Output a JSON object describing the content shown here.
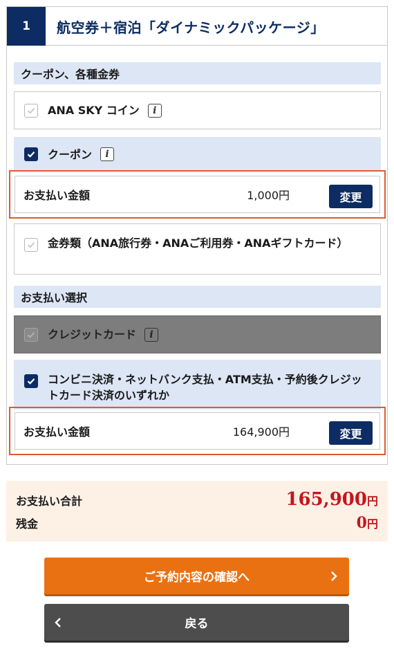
{
  "step": {
    "number": "1",
    "title": "航空券＋宿泊「ダイナミックパッケージ」"
  },
  "coupons": {
    "section_label": "クーポン、各種金券",
    "sky_coin": {
      "label": "ANA SKY コイン",
      "checked": false
    },
    "coupon": {
      "label": "クーポン",
      "checked": true,
      "payment_label": "お支払い金額",
      "payment_amount": "1,000円",
      "change_label": "変更"
    },
    "vouchers": {
      "label": "金券類（ANA旅行券・ANAご利用券・ANAギフトカード）",
      "checked": false
    }
  },
  "payment": {
    "section_label": "お支払い選択",
    "credit": {
      "label": "クレジットカード",
      "checked": false,
      "disabled": true
    },
    "convenience": {
      "label": "コンビニ決済・ネットバンク支払・ATM支払・予約後クレジットカード決済のいずれか",
      "checked": true,
      "payment_label": "お支払い金額",
      "payment_amount": "164,900円",
      "change_label": "変更"
    }
  },
  "summary": {
    "total_label": "お支払い合計",
    "total_value": "165,900",
    "total_unit": "円",
    "balance_label": "残金",
    "balance_value": "0",
    "balance_unit": "円"
  },
  "buttons": {
    "confirm_label": "ご予約内容の確認へ",
    "back_label": "戻る"
  },
  "colors": {
    "navy": "#0c2c63",
    "highlight_border": "#e05a2b",
    "orange_button": "#ea7112",
    "price_red": "#c4161c"
  },
  "icons": {
    "info": "info-icon",
    "check": "checkmark-icon",
    "next": "chevron-right-icon",
    "back": "chevron-left-icon"
  }
}
